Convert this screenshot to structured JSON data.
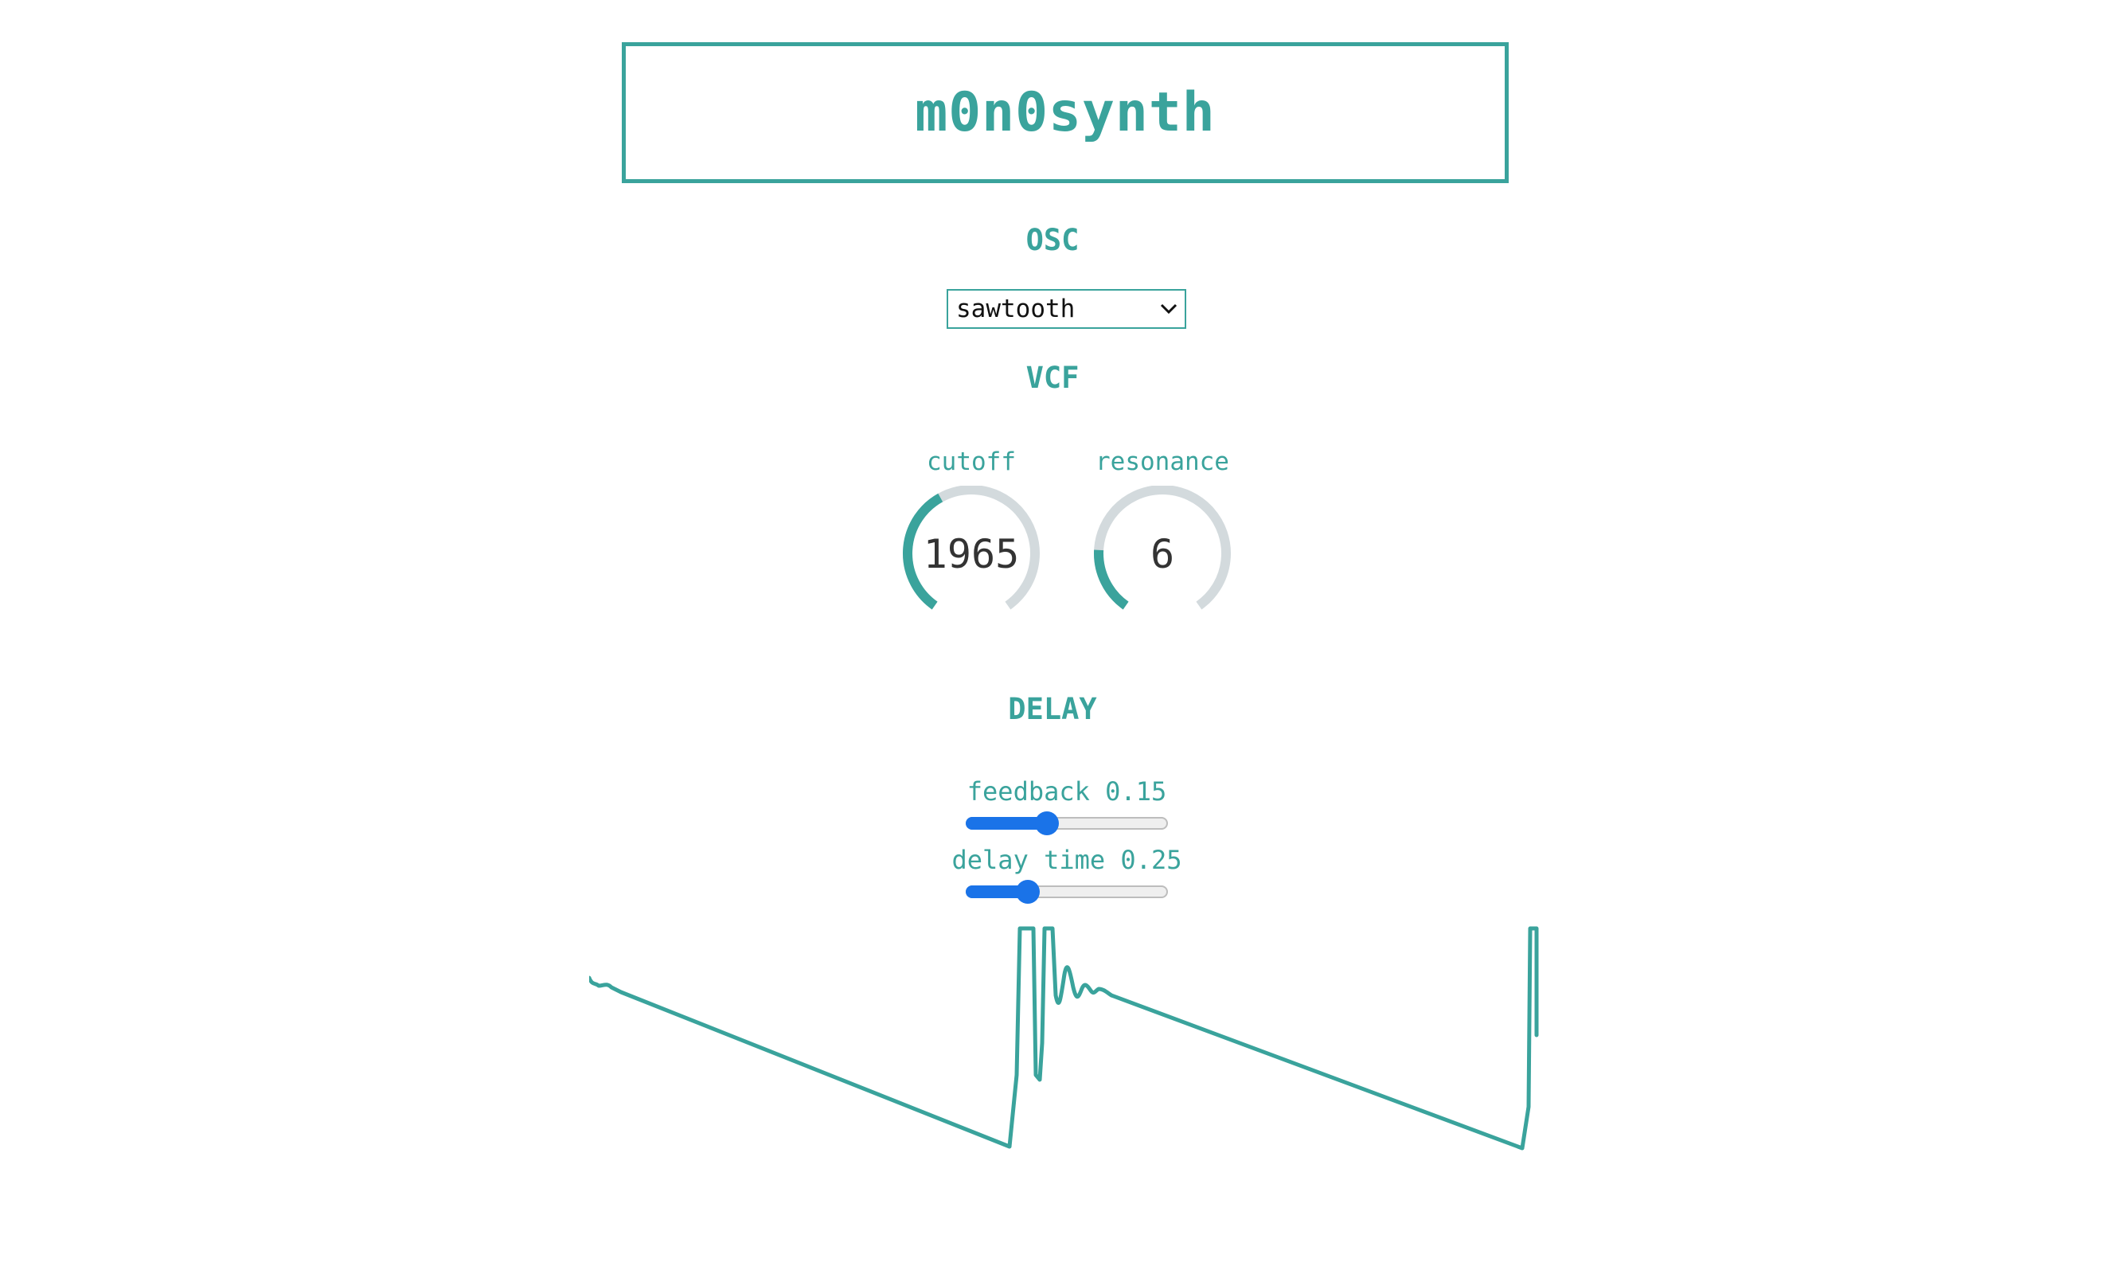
{
  "app": {
    "title": "m0n0synth"
  },
  "osc": {
    "section_label": "OSC",
    "waveform_selected": "sawtooth",
    "chevron_icon": "chevron-down-icon"
  },
  "vcf": {
    "section_label": "VCF",
    "cutoff": {
      "label": "cutoff",
      "value": "1965",
      "fraction": 0.4
    },
    "resonance": {
      "label": "resonance",
      "value": "6",
      "fraction": 0.2
    }
  },
  "delay": {
    "section_label": "DELAY",
    "feedback": {
      "label": "feedback 0.15",
      "fraction": 0.39
    },
    "delay_time": {
      "label": "delay time 0.25",
      "fraction": 0.28
    }
  },
  "colors": {
    "accent": "#3aa39c",
    "knob_track": "#d3dadd",
    "slider_active": "#1a73e8",
    "value_text": "#333333"
  }
}
